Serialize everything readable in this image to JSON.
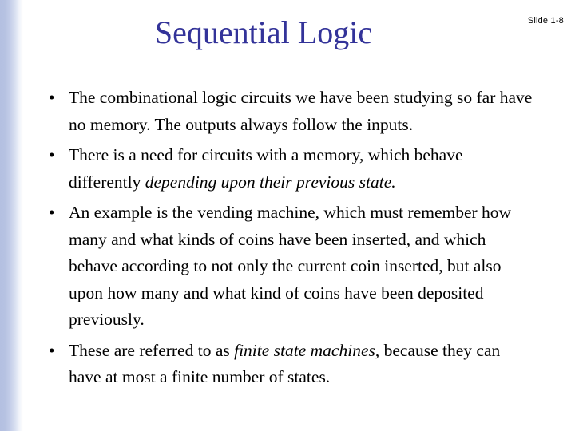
{
  "slide": {
    "title": "Sequential Logic",
    "title_color": "#333399",
    "slide_number": "Slide 1-8",
    "background_color": "#ffffff",
    "accent_stripe_color": "#b4c0e1",
    "body_text_color": "#000000",
    "bullet_marker": "•",
    "bullets": [
      {
        "marker": "•",
        "segments": [
          {
            "text": "The combinational logic circuits we have been studying so far have no memory.  The outputs always follow the inputs.",
            "style": "normal"
          }
        ]
      },
      {
        "marker": "•",
        "segments": [
          {
            "text": "There is a need for circuits with a memory, which behave differently ",
            "style": "normal"
          },
          {
            "text": "depending upon their previous state.",
            "style": "italic"
          }
        ]
      },
      {
        "marker": "•",
        "segments": [
          {
            "text": "An example is the vending machine, which must remember how many and what kinds of coins have been inserted, and which behave according to not only the current coin inserted, but also upon how many and what kind of coins have been deposited previously.",
            "style": "normal"
          }
        ]
      },
      {
        "marker": "•",
        "segments": [
          {
            "text": "These are referred to as ",
            "style": "normal"
          },
          {
            "text": "finite state machines",
            "style": "italic"
          },
          {
            "text": ", because they can have at most a finite number of states.",
            "style": "normal"
          }
        ]
      }
    ]
  }
}
